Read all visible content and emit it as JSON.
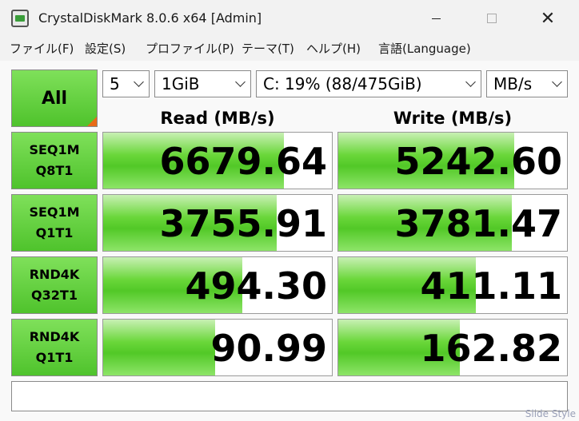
{
  "window": {
    "title": "CrystalDiskMark 8.0.6 x64 [Admin]",
    "close_glyph": "✕"
  },
  "menu": {
    "file": "ファイル(F)",
    "settings": "設定(S)",
    "profile": "プロファイル(P)",
    "theme": "テーマ(T)",
    "help": "ヘルプ(H)",
    "language": "言語(Language)"
  },
  "controls": {
    "all_label": "All",
    "count": "5",
    "size": "1GiB",
    "drive": "C: 19% (88/475GiB)",
    "unit": "MB/s"
  },
  "headers": {
    "read": "Read (MB/s)",
    "write": "Write (MB/s)"
  },
  "tests": [
    {
      "line1": "SEQ1M",
      "line2": "Q8T1",
      "read": "6679.64",
      "write": "5242.60",
      "read_fill": 0.79,
      "write_fill": 0.77
    },
    {
      "line1": "SEQ1M",
      "line2": "Q1T1",
      "read": "3755.91",
      "write": "3781.47",
      "read_fill": 0.76,
      "write_fill": 0.76
    },
    {
      "line1": "RND4K",
      "line2": "Q32T1",
      "read": "494.30",
      "write": "411.11",
      "read_fill": 0.61,
      "write_fill": 0.6
    },
    {
      "line1": "RND4K",
      "line2": "Q1T1",
      "read": "90.99",
      "write": "162.82",
      "read_fill": 0.49,
      "write_fill": 0.53
    }
  ],
  "comment": "",
  "watermark": "Slide Style",
  "colors": {
    "accent_green": "#52c827",
    "corner_orange": "#e86a17"
  }
}
